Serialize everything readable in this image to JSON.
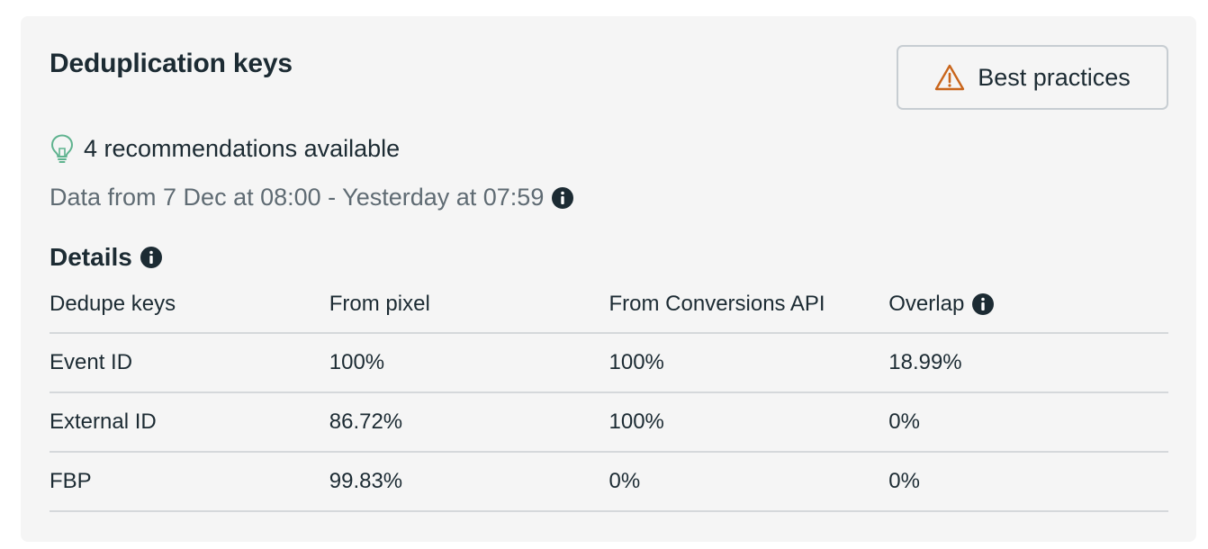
{
  "card": {
    "title": "Deduplication keys",
    "best_practices_label": "Best practices",
    "recommendations": "4 recommendations available",
    "date_range": "Data from 7 Dec at 08:00 - Yesterday at 07:59",
    "details_heading": "Details"
  },
  "table": {
    "headers": [
      "Dedupe keys",
      "From pixel",
      "From Conversions API",
      "Overlap"
    ],
    "rows": [
      [
        "Event ID",
        "100%",
        "100%",
        "18.99%"
      ],
      [
        "External ID",
        "86.72%",
        "100%",
        "0%"
      ],
      [
        "FBP",
        "99.83%",
        "0%",
        "0%"
      ]
    ]
  },
  "icons": {
    "warning": "warning-triangle-icon",
    "lightbulb": "lightbulb-icon",
    "info": "info-icon"
  },
  "colors": {
    "warning": "#c9651b",
    "lightbulb": "#5fb38f",
    "text_primary": "#1c2b33",
    "text_secondary": "#5f6b73",
    "card_bg": "#f5f5f5",
    "divider": "#d5d8db"
  }
}
